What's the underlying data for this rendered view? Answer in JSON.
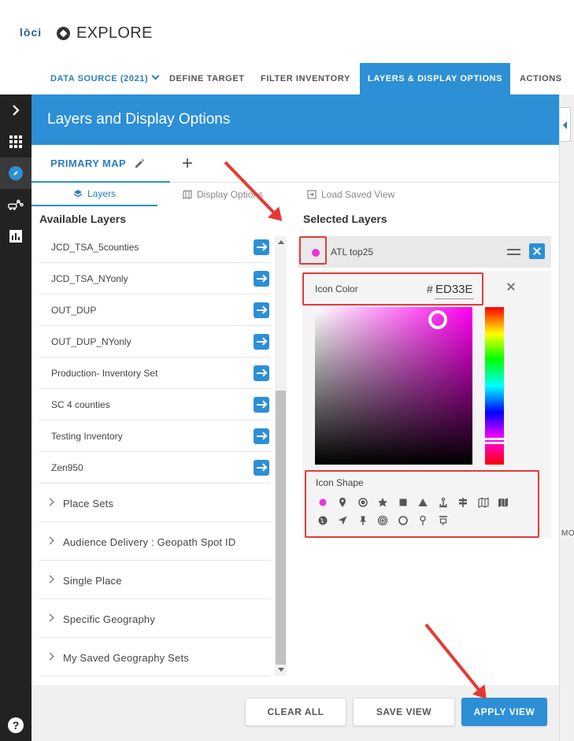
{
  "header": {
    "logo_text": "lōci",
    "app_title": "EXPLORE",
    "nav_tabs": {
      "data_source": "DATA SOURCE (2021)",
      "define_target": "DEFINE TARGET",
      "filter_inventory": "FILTER INVENTORY",
      "layers_display": "LAYERS & DISPLAY OPTIONS",
      "actions": "ACTIONS"
    }
  },
  "rail": {
    "items": [
      "expand-icon",
      "apps-grid-icon",
      "explore-compass-icon",
      "routes-icon",
      "analytics-icon"
    ],
    "bottom": "help-icon",
    "help_label": "?"
  },
  "panel": {
    "title": "Layers and Display Options",
    "map_tab": "PRIMARY MAP",
    "add_map": "+",
    "sub_tabs": {
      "layers": "Layers",
      "display_options": "Display Options",
      "load_saved_view": "Load Saved View"
    }
  },
  "available": {
    "title": "Available Layers",
    "layers": [
      "JCD_TSA_5counties",
      "JCD_TSA_NYonly",
      "OUT_DUP",
      "OUT_DUP_NYonly",
      "Production- Inventory Set",
      "SC 4 counties",
      "Testing Inventory",
      "Zen950"
    ],
    "groups": [
      "Place Sets",
      "Audience Delivery : Geopath Spot ID",
      "Single Place",
      "Specific Geography",
      "My Saved Geography Sets"
    ]
  },
  "selected": {
    "title": "Selected Layers",
    "layer_name": "ATL top25",
    "icon_color_label": "Icon Color",
    "hash": "#",
    "hex_value": "ED33E",
    "icon_color": "#ED33E0",
    "icon_shape_label": "Icon Shape",
    "shapes": [
      "circle-icon",
      "map-pin-icon",
      "target-icon",
      "star-icon",
      "square-icon",
      "triangle-icon",
      "anchor-icon",
      "signpost-icon",
      "map-outline-icon",
      "map-filled-icon",
      "globe-icon",
      "navigation-arrow-icon",
      "pushpin-icon",
      "radio-target-icon",
      "circle-outline-icon",
      "small-pin-icon",
      "billboard-icon"
    ]
  },
  "map_strip": {
    "label": "MO"
  },
  "footer": {
    "clear_all": "CLEAR ALL",
    "save_view": "SAVE VIEW",
    "apply_view": "APPLY VIEW"
  },
  "colors": {
    "primary": "#2d8fd5",
    "annotation_red": "#e53935",
    "rail": "#222222"
  }
}
